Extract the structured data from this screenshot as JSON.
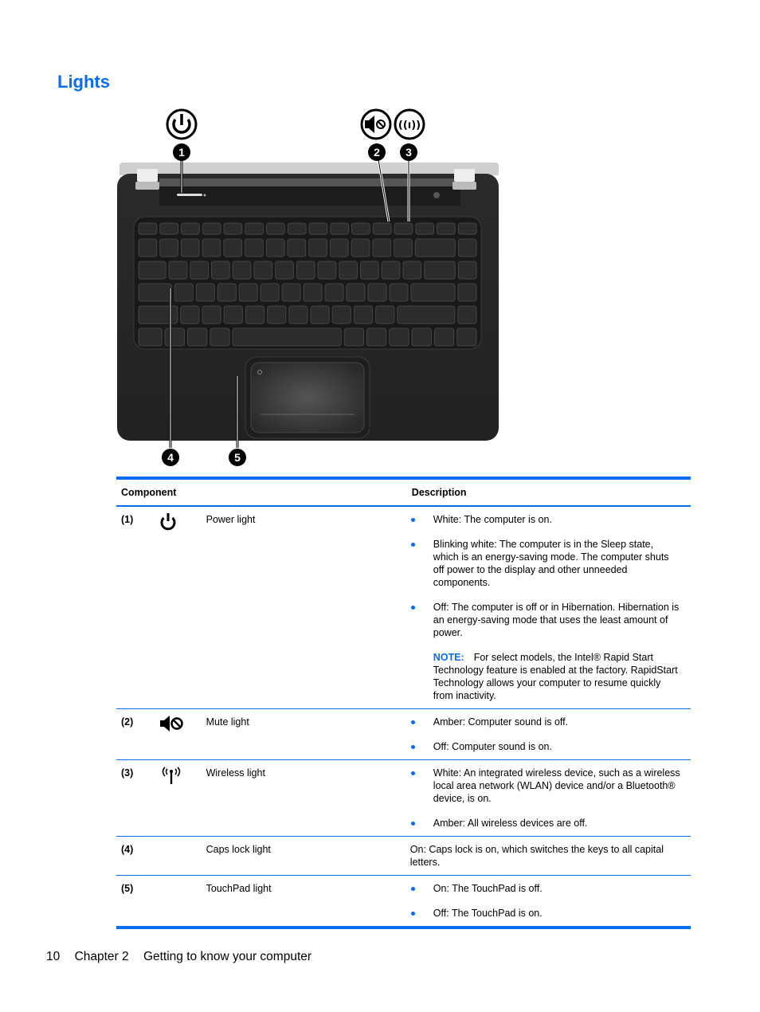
{
  "page": {
    "title": "Lights",
    "footer": {
      "page_number": "10",
      "chapter": "Chapter 2",
      "chapter_title": "Getting to know your computer"
    }
  },
  "figure": {
    "callouts": [
      {
        "number": "1",
        "icon": "power-icon"
      },
      {
        "number": "2",
        "icon": "mute-icon"
      },
      {
        "number": "3",
        "icon": "wireless-icon"
      },
      {
        "number": "4",
        "icon": ""
      },
      {
        "number": "5",
        "icon": ""
      }
    ]
  },
  "table": {
    "headers": {
      "component": "Component",
      "description": "Description"
    },
    "rows": [
      {
        "num": "(1)",
        "icon": "power-icon",
        "name": "Power light",
        "bullets": [
          "White: The computer is on.",
          "Blinking white: The computer is in the Sleep state, which is an energy-saving mode. The computer shuts off power to the display and other unneeded components.",
          "Off: The computer is off or in Hibernation. Hibernation is an energy-saving mode that uses the least amount of power."
        ],
        "note_label": "NOTE:",
        "note_text": "For select models, the Intel® Rapid Start Technology feature is enabled at the factory. RapidStart Technology allows your computer to resume quickly from inactivity."
      },
      {
        "num": "(2)",
        "icon": "mute-icon",
        "name": "Mute light",
        "bullets": [
          "Amber: Computer sound is off.",
          "Off: Computer sound is on."
        ]
      },
      {
        "num": "(3)",
        "icon": "wireless-icon",
        "name": "Wireless light",
        "bullets": [
          "White: An integrated wireless device, such as a wireless local area network (WLAN) device and/or a Bluetooth® device, is on.",
          "Amber: All wireless devices are off."
        ]
      },
      {
        "num": "(4)",
        "icon": "",
        "name": "Caps lock light",
        "text": "On: Caps lock is on, which switches the keys to all capital letters."
      },
      {
        "num": "(5)",
        "icon": "",
        "name": "TouchPad light",
        "bullets": [
          "On: The TouchPad is off.",
          "Off: The TouchPad is on."
        ]
      }
    ]
  },
  "colors": {
    "accent": "#0a6cf0"
  }
}
